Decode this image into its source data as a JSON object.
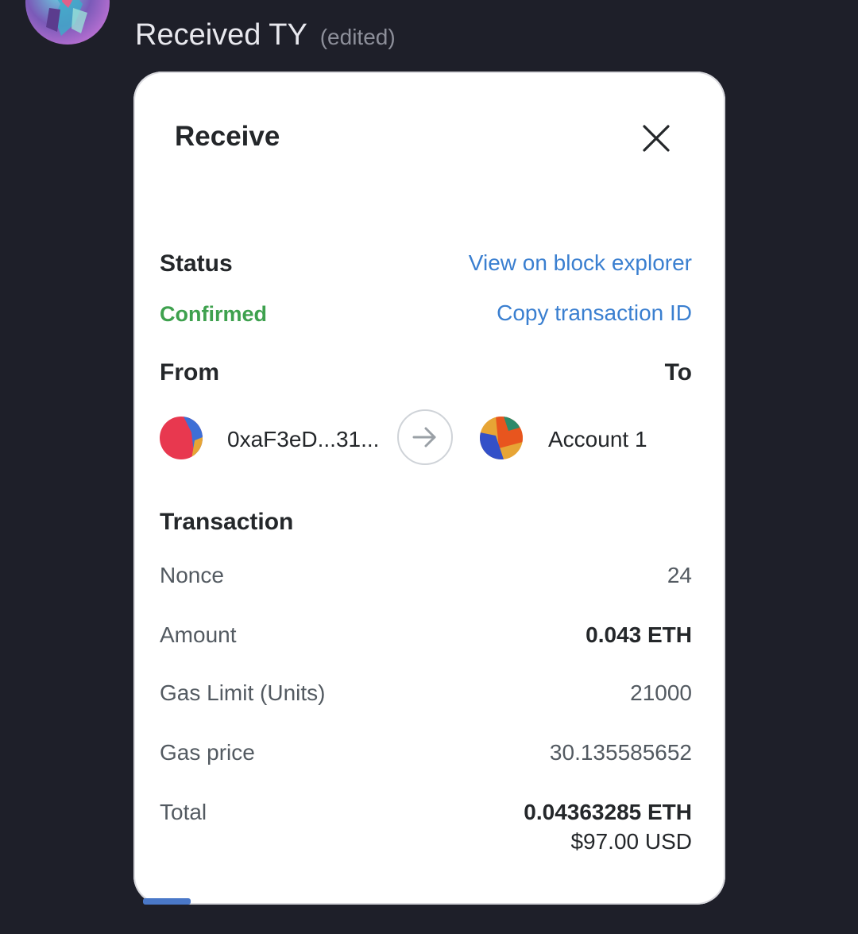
{
  "chat": {
    "avatar_icon": "user-avatar-icon",
    "message": "Received TY",
    "edited_tag": "(edited)"
  },
  "modal": {
    "title": "Receive",
    "close_icon": "close-icon",
    "status_label": "Status",
    "status_value": "Confirmed",
    "status_color": "#3ea14e",
    "view_explorer_link": "View on block explorer",
    "copy_tx_link": "Copy transaction ID",
    "link_color": "#3a7fd0",
    "from_label": "From",
    "to_label": "To",
    "from_address": "0xaF3eD...31...",
    "to_account": "Account 1",
    "transaction_label": "Transaction",
    "rows": [
      {
        "label": "Nonce",
        "value": "24"
      },
      {
        "label": "Amount",
        "value": "0.043 ETH"
      },
      {
        "label": "Gas Limit (Units)",
        "value": "21000"
      },
      {
        "label": "Gas price",
        "value": "30.135585652"
      },
      {
        "label": "Total",
        "value": "0.04363285 ETH"
      }
    ],
    "total_usd": "$97.00 USD"
  }
}
